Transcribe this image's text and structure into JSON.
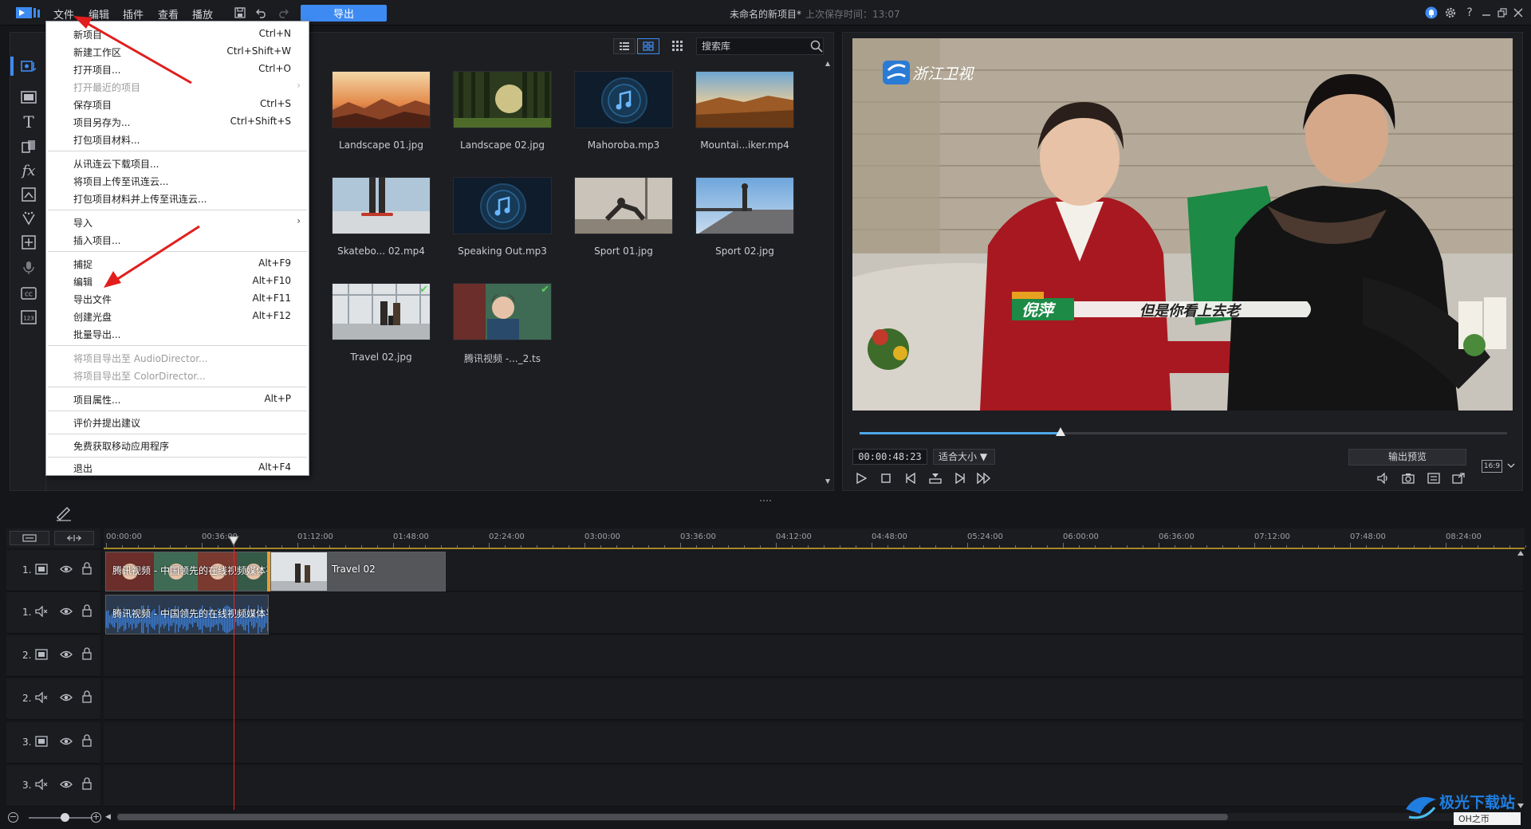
{
  "titlebar": {
    "menus": [
      "文件",
      "编辑",
      "插件",
      "查看",
      "播放"
    ],
    "export_label": "导出",
    "project_title": "未命名的新项目*",
    "save_time": "上次保存时间：13:07"
  },
  "file_menu": {
    "items": [
      {
        "label": "新项目",
        "shortcut": "Ctrl+N"
      },
      {
        "label": "新建工作区",
        "shortcut": "Ctrl+Shift+W"
      },
      {
        "label": "打开项目...",
        "shortcut": "Ctrl+O"
      },
      {
        "label": "打开最近的项目",
        "shortcut": ""
      },
      {
        "label": "保存项目",
        "shortcut": "Ctrl+S"
      },
      {
        "label": "项目另存为...",
        "shortcut": "Ctrl+Shift+S"
      },
      {
        "label": "打包项目材料...",
        "shortcut": ""
      },
      {
        "label": "从讯连云下载项目...",
        "shortcut": ""
      },
      {
        "label": "将项目上传至讯连云...",
        "shortcut": ""
      },
      {
        "label": "打包项目材料并上传至讯连云...",
        "shortcut": ""
      },
      {
        "label": "导入",
        "shortcut": ""
      },
      {
        "label": "插入项目...",
        "shortcut": ""
      },
      {
        "label": "捕捉",
        "shortcut": "Alt+F9"
      },
      {
        "label": "编辑",
        "shortcut": "Alt+F10"
      },
      {
        "label": "导出文件",
        "shortcut": "Alt+F11"
      },
      {
        "label": "创建光盘",
        "shortcut": "Alt+F12"
      },
      {
        "label": "批量导出...",
        "shortcut": ""
      },
      {
        "label": "将项目导出至 AudioDirector...",
        "shortcut": ""
      },
      {
        "label": "将项目导出至 ColorDirector...",
        "shortcut": ""
      },
      {
        "label": "项目属性...",
        "shortcut": "Alt+P"
      },
      {
        "label": "评价并提出建议",
        "shortcut": ""
      },
      {
        "label": "免费获取移动应用程序",
        "shortcut": ""
      },
      {
        "label": "退出",
        "shortcut": "Alt+F4"
      }
    ]
  },
  "media_library": {
    "search_value": "搜索库",
    "items": [
      {
        "label": "Landscape 01.jpg"
      },
      {
        "label": "Landscape 02.jpg"
      },
      {
        "label": "Mahoroba.mp3"
      },
      {
        "label": "Mountai...iker.mp4"
      },
      {
        "label": "Skatebo... 02.mp4"
      },
      {
        "label": "Speaking Out.mp3"
      },
      {
        "label": "Sport 01.jpg"
      },
      {
        "label": "Sport 02.jpg"
      },
      {
        "label": "Travel 02.jpg"
      },
      {
        "label": "腾讯视频 -..._2.ts"
      }
    ]
  },
  "preview": {
    "channel_logo": "浙江卫视",
    "caption_name": "倪萍",
    "caption_text": "但是你看上去老",
    "timecode": "00:00:48:23",
    "fit_label": "适合大小 ▼",
    "output_preview_label": "输出预览",
    "aspect_ratio": "16:9",
    "progress": 0.31
  },
  "timeline": {
    "ruler_labels": [
      "00:00:00",
      "00:36:00",
      "01:12:00",
      "01:48:00",
      "02:24:00",
      "03:00:00",
      "03:36:00",
      "04:12:00",
      "04:48:00",
      "05:24:00",
      "06:00:00",
      "06:36:00",
      "07:12:00",
      "07:48:00",
      "08:24:00"
    ],
    "tracks": [
      {
        "num": "1.",
        "type": "video"
      },
      {
        "num": "1.",
        "type": "audio"
      },
      {
        "num": "2.",
        "type": "video"
      },
      {
        "num": "2.",
        "type": "audio"
      },
      {
        "num": "3.",
        "type": "video"
      },
      {
        "num": "3.",
        "type": "audio"
      }
    ],
    "clips": {
      "video_clip_label": "腾讯视频 - 中国领先的在线视频媒体平",
      "travel_clip_label": "Travel 02",
      "audio_clip_label": "腾讯视频 - 中国领先的在线视频媒体平"
    }
  },
  "watermark": {
    "line1": "极光下载站",
    "line2": "OH之帀"
  },
  "colors": {
    "accent": "#3d8bf2",
    "playhead": "#e0282e",
    "menu_bg": "#ffffff",
    "panel_bg": "#1d1e22"
  }
}
